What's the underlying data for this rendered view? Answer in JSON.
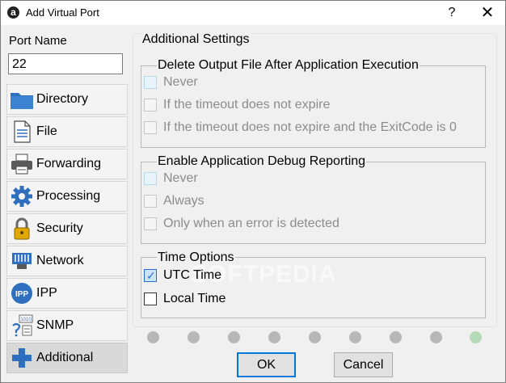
{
  "window": {
    "title": "Add Virtual Port",
    "app_icon_glyph": "a",
    "help_glyph": "?",
    "close_glyph": "✕"
  },
  "port": {
    "label": "Port Name",
    "value": "22"
  },
  "sidebar": {
    "items": [
      {
        "label": "Directory",
        "icon": "folder-icon"
      },
      {
        "label": "File",
        "icon": "file-icon"
      },
      {
        "label": "Forwarding",
        "icon": "printer-icon"
      },
      {
        "label": "Processing",
        "icon": "gear-icon"
      },
      {
        "label": "Security",
        "icon": "lock-icon"
      },
      {
        "label": "Network",
        "icon": "network-icon"
      },
      {
        "label": "IPP",
        "icon": "ipp-icon",
        "glyph": "IPP"
      },
      {
        "label": "SNMP",
        "icon": "snmp-icon",
        "glyph": "1010"
      },
      {
        "label": "Additional",
        "icon": "plus-icon",
        "active": true
      }
    ]
  },
  "settings": {
    "title": "Additional Settings",
    "delete_group": {
      "title": "Delete Output File After Application Execution",
      "options": [
        {
          "label": "Never",
          "checked": false,
          "enabled": false
        },
        {
          "label": "If the timeout does not expire",
          "checked": false,
          "enabled": false
        },
        {
          "label": "If the timeout does not expire and the ExitCode is 0",
          "checked": false,
          "enabled": false
        }
      ]
    },
    "debug_group": {
      "title": "Enable Application Debug Reporting",
      "options": [
        {
          "label": "Never",
          "checked": false,
          "enabled": false
        },
        {
          "label": "Always",
          "checked": false,
          "enabled": false
        },
        {
          "label": "Only when an error is detected",
          "checked": false,
          "enabled": false
        }
      ]
    },
    "time_group": {
      "title": "Time Options",
      "options": [
        {
          "label": "UTC Time",
          "checked": true,
          "enabled": true
        },
        {
          "label": "Local Time",
          "checked": false,
          "enabled": true
        }
      ]
    }
  },
  "wizard": {
    "steps": 9,
    "current_step": 9
  },
  "buttons": {
    "ok": "OK",
    "cancel": "Cancel"
  },
  "watermark": "SOFTPEDIA",
  "colors": {
    "accent": "#0078d7",
    "check": "#1e6fd0",
    "icon_blue": "#2f6fbf",
    "dot": "#b7b7b7",
    "dot_current": "#b6dab8"
  }
}
